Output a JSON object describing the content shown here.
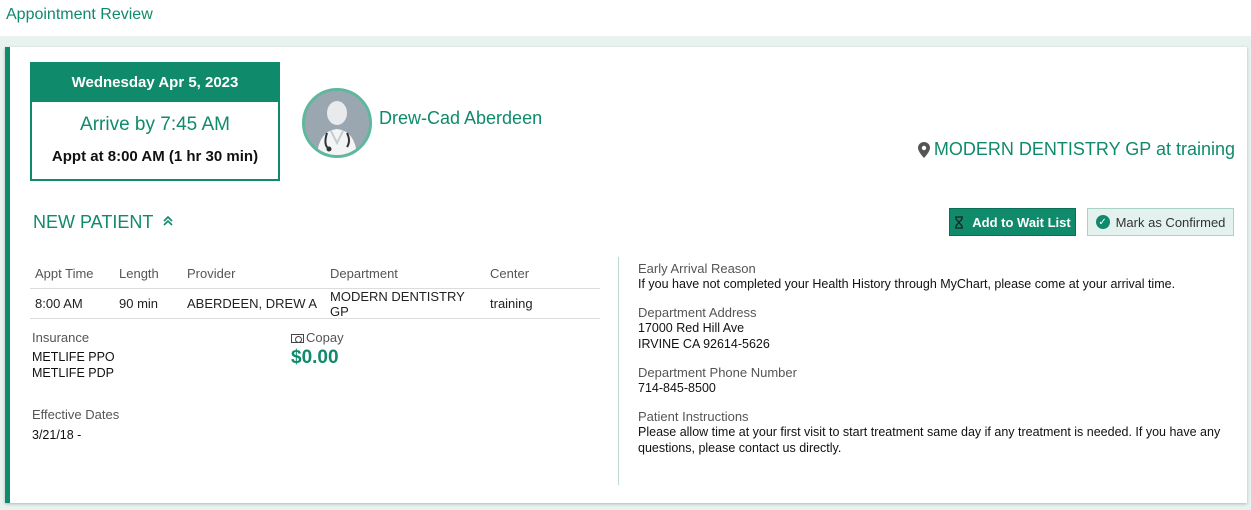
{
  "page": {
    "title": "Appointment Review"
  },
  "appointment": {
    "date": "Wednesday Apr 5, 2023",
    "arrive": "Arrive by 7:45 AM",
    "appt_time": "Appt at 8:00 AM (1 hr 30 min)"
  },
  "provider": {
    "name": "Drew-Cad Aberdeen",
    "avatar_icon": "doctor-avatar-icon"
  },
  "location": {
    "icon": "map-pin-icon",
    "text": "MODERN DENTISTRY GP at training"
  },
  "section": {
    "title": "NEW PATIENT",
    "toggle_icon": "chevron-double-up-icon"
  },
  "actions": {
    "wait_list": "Add to Wait List",
    "confirm": "Mark as Confirmed"
  },
  "table": {
    "headers": [
      "Appt Time",
      "Length",
      "Provider",
      "Department",
      "Center"
    ],
    "row": [
      "8:00 AM",
      "90 min",
      "ABERDEEN, DREW A",
      "MODERN DENTISTRY GP",
      "training"
    ]
  },
  "insurance": {
    "label": "Insurance",
    "plans": [
      "METLIFE PPO",
      "METLIFE PDP"
    ]
  },
  "copay": {
    "label": "Copay",
    "amount": "$0.00"
  },
  "effective": {
    "label": "Effective Dates",
    "value": "3/21/18 -"
  },
  "details": {
    "early_label": "Early Arrival Reason",
    "early_value": "If you have not completed your Health History through MyChart, please come at your arrival time.",
    "address_label": "Department Address",
    "address_line1": "17000 Red Hill Ave",
    "address_line2": "IRVINE CA 92614-5626",
    "phone_label": "Department Phone Number",
    "phone_value": "714-845-8500",
    "instructions_label": "Patient Instructions",
    "instructions_value": "Please allow time at your first visit to start treatment same day if any treatment is needed.  If you have any questions, please contact us directly."
  },
  "colors": {
    "accent": "#0f8a6b",
    "accent_light": "#e3f2ee",
    "band": "#e8f3f0"
  }
}
